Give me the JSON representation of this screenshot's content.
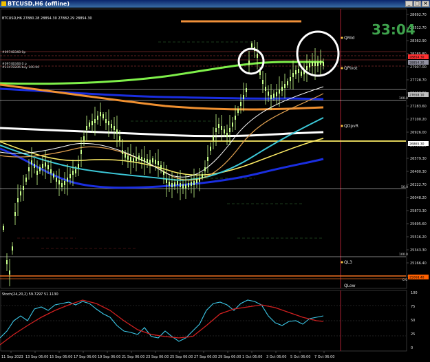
{
  "window": {
    "title": "BTCUSD,H6 (offline)"
  },
  "ohlc": "BTCUSD,H6  27880.28 28854.30 27882.29 28854.30",
  "timer": "33:04",
  "price_axis": [
    "28692.70",
    "28512.70",
    "28362.90",
    "28185.80",
    "27907.00",
    "27728.70",
    "27458.00",
    "27283.60",
    "27100.20",
    "26926.00",
    "26750.20",
    "26579.30",
    "26400.30",
    "26222.70",
    "26048.20",
    "25873.30",
    "25695.60",
    "25516.20",
    "25343.30",
    "25166.40",
    "24998.10"
  ],
  "price_boxes": [
    {
      "label": "28854.30",
      "color": "#ff3030"
    },
    {
      "label": "28854.30",
      "color": "#9090a0"
    },
    {
      "label": "27658.10",
      "color": "#c0c0c0"
    },
    {
      "label": "26865.30",
      "color": "#ffffff"
    },
    {
      "label": "25068.40",
      "color": "#ff6000"
    }
  ],
  "levels": {
    "qmid": "QMid",
    "qpivot": "QPivot",
    "qpdh": "QDpvR",
    "ql3": "QL3",
    "qlow": "QLow",
    "fib_100_top": "100.0",
    "fib_50": "50.0",
    "fib_100_bot": "100.0",
    "fib_0": "0.0",
    "lbl1": "#0974B34B 0p",
    "lbl2": "#0974B34B 0 p",
    "lbl3": "#2347B2B6 buy 100.00"
  },
  "stoch": {
    "label": "Stoch(24,20,2) 59.7297 51.1130",
    "axis": [
      "100",
      "75",
      "50",
      "25",
      "0"
    ]
  },
  "time_axis": [
    "11 Sep 2023",
    "13 Sep 06:00",
    "15 Sep 06:00",
    "17 Sep 06:00",
    "19 Sep 06:00",
    "21 Sep 06:00",
    "23 Sep 06:00",
    "25 Sep 06:00",
    "27 Sep 06:00",
    "29 Sep 06:00",
    "1 Oct 06:00",
    "3 Oct 06:00",
    "5 Oct 06:00",
    "7 Oct 06:00"
  ],
  "colors": {
    "candles": "#c8ff8c",
    "ma_green": "#7ff04a",
    "ma_blue": "#1a2ee0",
    "ma_orange": "#f09030",
    "ma_white": "#ffffff",
    "ma_yellow": "#ffee66",
    "ma_cyan": "#3cc8d8",
    "stoch_main": "#3cc8e8",
    "stoch_signal": "#d02020",
    "timer": "#3fa34d"
  }
}
